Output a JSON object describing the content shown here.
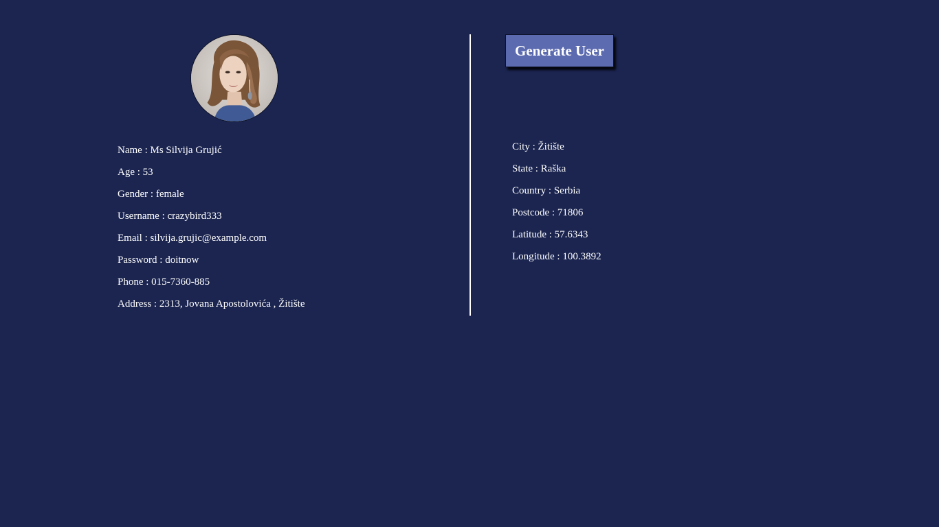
{
  "user": {
    "photo_icon": "user-portrait",
    "details": [
      {
        "label": "Name",
        "value": "Ms Silvija Grujić"
      },
      {
        "label": "Age",
        "value": "53"
      },
      {
        "label": "Gender",
        "value": "female"
      },
      {
        "label": "Username",
        "value": "crazybird333"
      },
      {
        "label": "Email",
        "value": "silvija.grujic@example.com"
      },
      {
        "label": "Password",
        "value": "doitnow"
      },
      {
        "label": "Phone",
        "value": "015-7360-885"
      },
      {
        "label": "Address",
        "value": "2313, Jovana Apostolovića , Žitište"
      }
    ]
  },
  "location": {
    "details": [
      {
        "label": "City",
        "value": "Žitište"
      },
      {
        "label": "State",
        "value": "Raška"
      },
      {
        "label": "Country",
        "value": "Serbia"
      },
      {
        "label": "Postcode",
        "value": "71806"
      },
      {
        "label": "Latitude",
        "value": "57.6343"
      },
      {
        "label": "Longitude",
        "value": "100.3892"
      }
    ]
  },
  "actions": {
    "generate_label": "Generate User"
  },
  "colors": {
    "background": "#1b2550",
    "button": "#5c6bb0",
    "text": "#ffffff"
  }
}
